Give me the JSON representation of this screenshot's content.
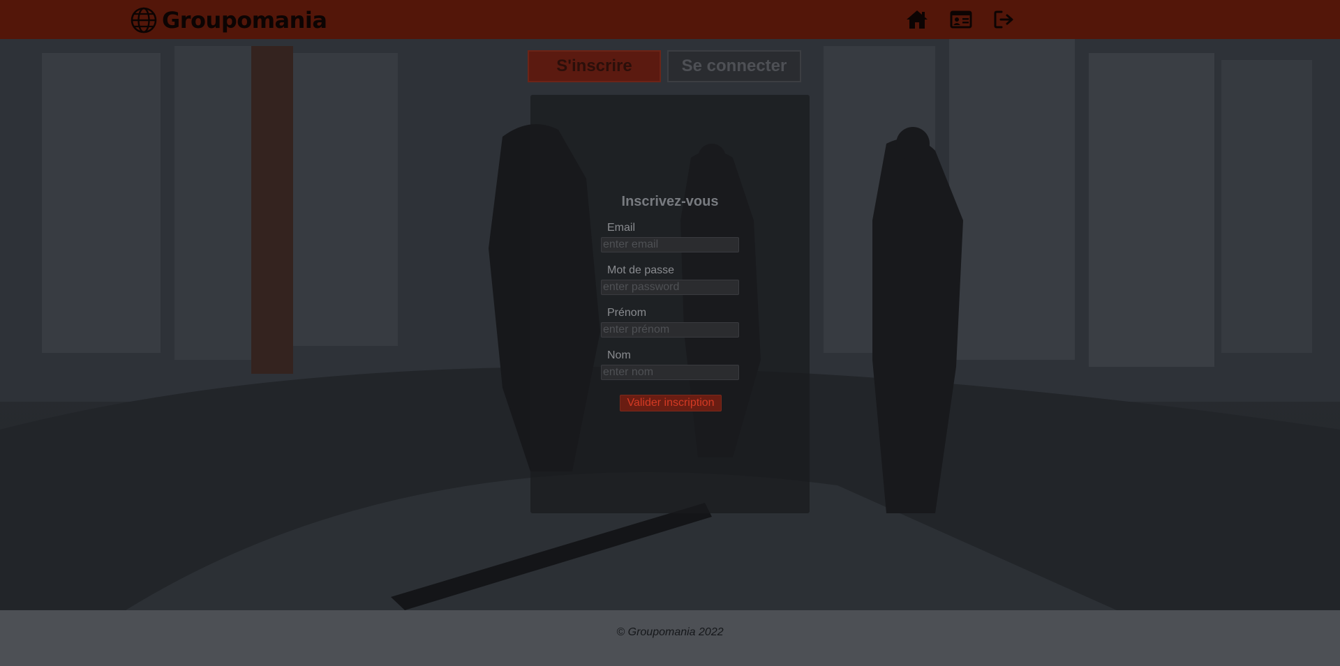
{
  "header": {
    "brand": "Groupomania",
    "nav": [
      {
        "icon": "home-icon"
      },
      {
        "icon": "profile-card-icon"
      },
      {
        "icon": "logout-icon"
      }
    ]
  },
  "tabs": {
    "signup_label": "S'inscrire",
    "login_label": "Se connecter",
    "active": "signup"
  },
  "form": {
    "title": "Inscrivez-vous",
    "email_label": "Email",
    "email_placeholder": "enter email",
    "password_label": "Mot de passe",
    "password_placeholder": "enter password",
    "firstname_label": "Prénom",
    "firstname_placeholder": "enter prénom",
    "lastname_label": "Nom",
    "lastname_placeholder": "enter nom",
    "submit_label": "Valider inscription"
  },
  "footer": {
    "text": "© Groupomania 2022"
  },
  "colors": {
    "header_bg": "#531609",
    "accent": "#6a1d12",
    "accent_text": "#d43a24",
    "footer_bg": "#4d5055"
  }
}
